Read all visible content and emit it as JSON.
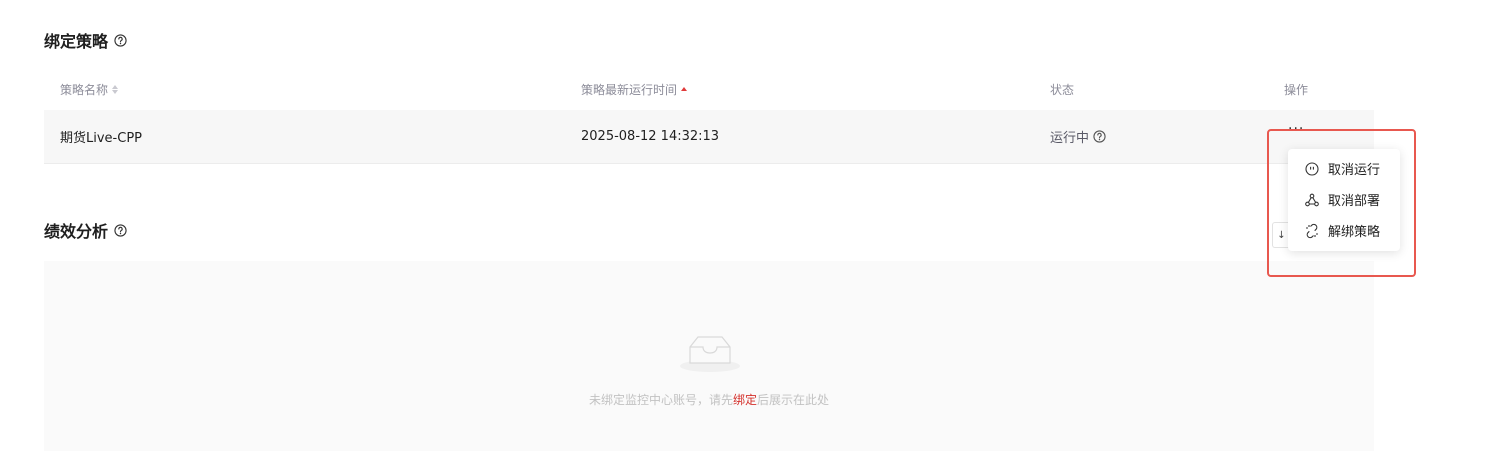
{
  "bind_section": {
    "title": "绑定策略",
    "columns": {
      "name": "策略名称",
      "last_run": "策略最新运行时间",
      "status": "状态",
      "actions": "操作"
    },
    "rows": [
      {
        "name": "期货Live-CPP",
        "last_run": "2025-08-12 14:32:13",
        "status": "运行中",
        "more": "···"
      }
    ],
    "dropdown": [
      {
        "label": "取消运行",
        "icon": "pause-circle-icon"
      },
      {
        "label": "取消部署",
        "icon": "deploy-nodes-icon"
      },
      {
        "label": "解绑策略",
        "icon": "unlink-icon"
      }
    ]
  },
  "perf_section": {
    "title": "绩效分析",
    "right_button_fragment": "↓",
    "empty_text_before": "未绑定监控中心账号，请先",
    "empty_link": "绑定",
    "empty_text_after": "后展示在此处"
  },
  "colors": {
    "accent_red": "#d4302b",
    "highlight_border": "#e8584f",
    "muted_text": "#8c8c99"
  }
}
